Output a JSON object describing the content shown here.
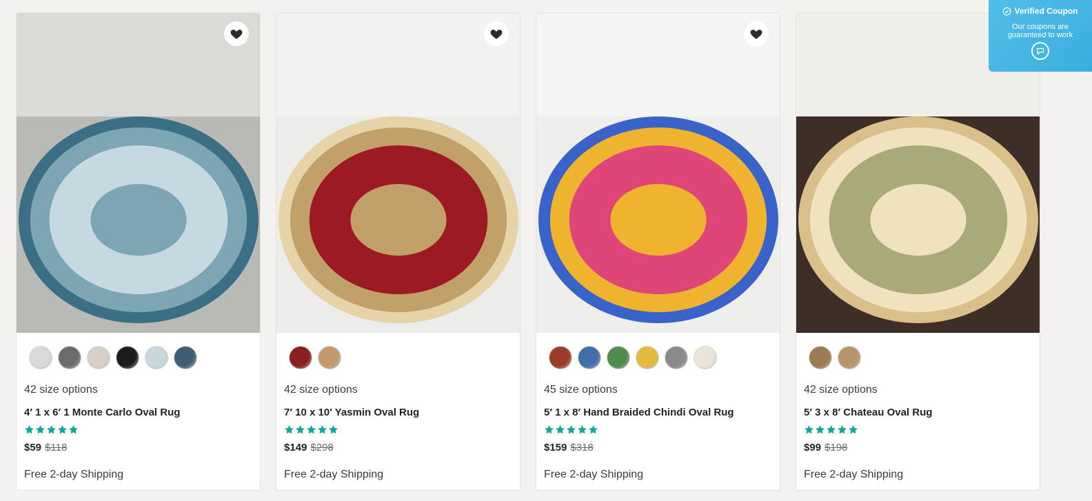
{
  "products": [
    {
      "sizes": "42 size options",
      "name": "4′ 1 x 6′ 1 Monte Carlo Oval Rug",
      "rating": 5,
      "price": "$59",
      "original_price": "$118",
      "shipping": "Free 2-day Shipping",
      "swatches": [
        "#d9d9d7",
        "#6b6b6b",
        "#d7cfc8",
        "#1c1c1c",
        "#c9d6dc",
        "#3f5e72"
      ],
      "rug": {
        "field": "#c7d9e0",
        "border": "#3b6f85",
        "accent": "#7ea5b4",
        "floor": "#b9bab6",
        "wall": "#dcdad6"
      }
    },
    {
      "sizes": "42 size options",
      "name": "7′ 10 x 10′ Yasmin Oval Rug",
      "rating": 5,
      "price": "$149",
      "original_price": "$298",
      "shipping": "Free 2-day Shipping",
      "swatches": [
        "#8b1f1f",
        "#c49a6c"
      ],
      "rug": {
        "field": "#9b1a24",
        "border": "#e6d3a8",
        "accent": "#c2a06a",
        "floor": "#ececea",
        "wall": "#f2f2f0"
      }
    },
    {
      "sizes": "45 size options",
      "name": "5′ 1 x 8′ Hand Braided Chindi Oval Rug",
      "rating": 5,
      "price": "$159",
      "original_price": "$318",
      "shipping": "Free 2-day Shipping",
      "swatches": [
        "#9c3b2a",
        "#3f6ea8",
        "#4f8a4f",
        "#e3bb3e",
        "#8a8a8a",
        "#ece4d6"
      ],
      "rug": {
        "field": "#e0457a",
        "border": "#3a63c9",
        "accent": "#f0b330",
        "floor": "#eeeeec",
        "wall": "#f4f4f2"
      }
    },
    {
      "sizes": "42 size options",
      "name": "5′ 3 x 8′ Chateau Oval Rug",
      "rating": 5,
      "price": "$99",
      "original_price": "$198",
      "shipping": "Free 2-day Shipping",
      "swatches": [
        "#9c7a52",
        "#b8946a"
      ],
      "rug": {
        "field": "#a9aa78",
        "border": "#d9c08a",
        "accent": "#efe2bd",
        "floor": "#3d2f28",
        "wall": "#eeeeea"
      }
    }
  ],
  "coupon": {
    "title": "Verified Coupon",
    "text": "Our coupons are guaranteed to work"
  },
  "colors": {
    "star": "#11a89a",
    "heart": "#2b2b2b",
    "coupon_bg": "#3aaedf"
  }
}
